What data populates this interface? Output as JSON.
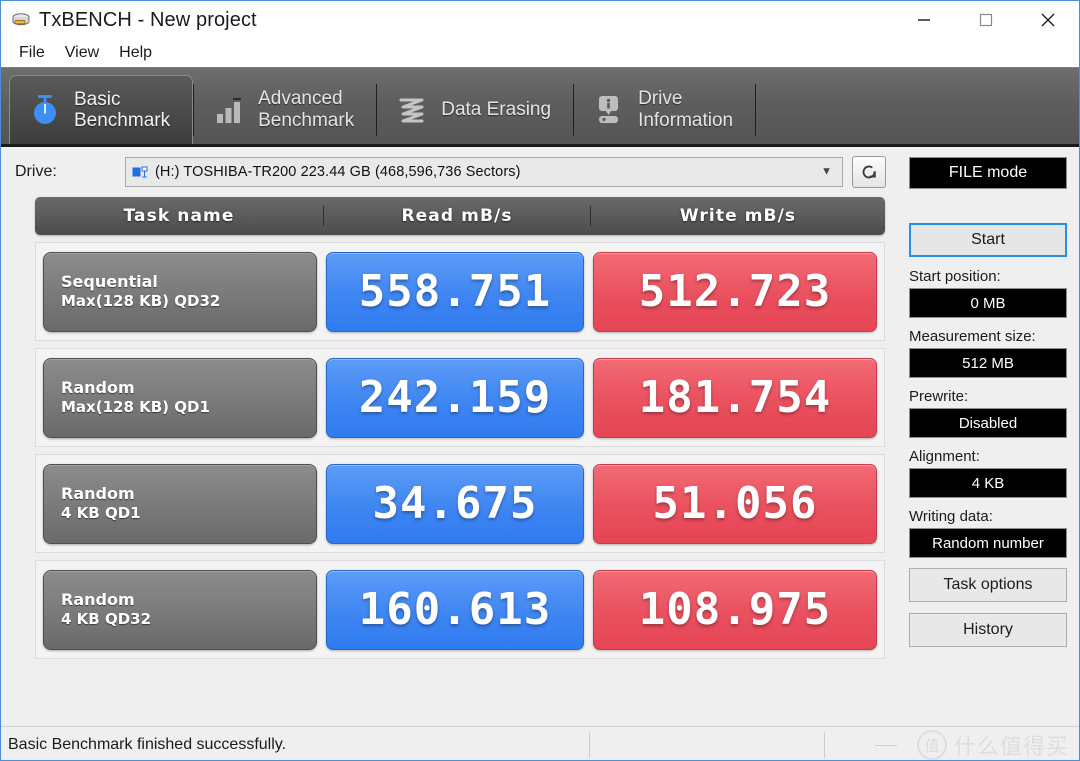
{
  "window": {
    "title": "TxBENCH - New project",
    "app_icon": "drive-app-icon",
    "controls": {
      "minimize": "minimize-icon",
      "maximize": "maximize-icon",
      "close": "close-icon"
    }
  },
  "menubar": {
    "items": [
      {
        "label": "File"
      },
      {
        "label": "View"
      },
      {
        "label": "Help"
      }
    ]
  },
  "tabs": [
    {
      "label": "Basic\nBenchmark",
      "icon": "stopwatch-icon",
      "active": true
    },
    {
      "label": "Advanced\nBenchmark",
      "icon": "bar-chart-icon",
      "active": false
    },
    {
      "label": "Data Erasing",
      "icon": "shredder-icon",
      "active": false
    },
    {
      "label": "Drive\nInformation",
      "icon": "drive-info-icon",
      "active": false
    }
  ],
  "drive": {
    "label": "Drive:",
    "selected": "(H:) TOSHIBA-TR200  223.44 GB (468,596,736 Sectors)",
    "icon": "drive-icon",
    "dropdown_arrow": "chevron-down-icon",
    "refresh_icon": "refresh-icon"
  },
  "table": {
    "headers": [
      "Task name",
      "Read mB/s",
      "Write mB/s"
    ],
    "rows": [
      {
        "task_line1": "Sequential",
        "task_line2": "Max(128 KB) QD32",
        "read": "558.751",
        "write": "512.723"
      },
      {
        "task_line1": "Random",
        "task_line2": "Max(128 KB) QD1",
        "read": "242.159",
        "write": "181.754"
      },
      {
        "task_line1": "Random",
        "task_line2": "4 KB QD1",
        "read": "34.675",
        "write": "51.056"
      },
      {
        "task_line1": "Random",
        "task_line2": "4 KB QD32",
        "read": "160.613",
        "write": "108.975"
      }
    ]
  },
  "sidebar": {
    "mode": "FILE mode",
    "start_button": "Start",
    "fields": [
      {
        "label": "Start position:",
        "value": "0 MB"
      },
      {
        "label": "Measurement size:",
        "value": "512 MB"
      },
      {
        "label": "Prewrite:",
        "value": "Disabled"
      },
      {
        "label": "Alignment:",
        "value": "4 KB"
      },
      {
        "label": "Writing data:",
        "value": "Random number"
      }
    ],
    "task_options_button": "Task options",
    "history_button": "History"
  },
  "statusbar": {
    "message": "Basic Benchmark finished successfully.",
    "watermark_badge": "值",
    "watermark_text": "什么值得买"
  },
  "colors": {
    "read_blue": "#3f86f2",
    "write_red": "#ea505e",
    "tab_bar": "#5e5e5e",
    "accent_blue": "#2a8fe0",
    "panel_bg": "#efefef"
  }
}
